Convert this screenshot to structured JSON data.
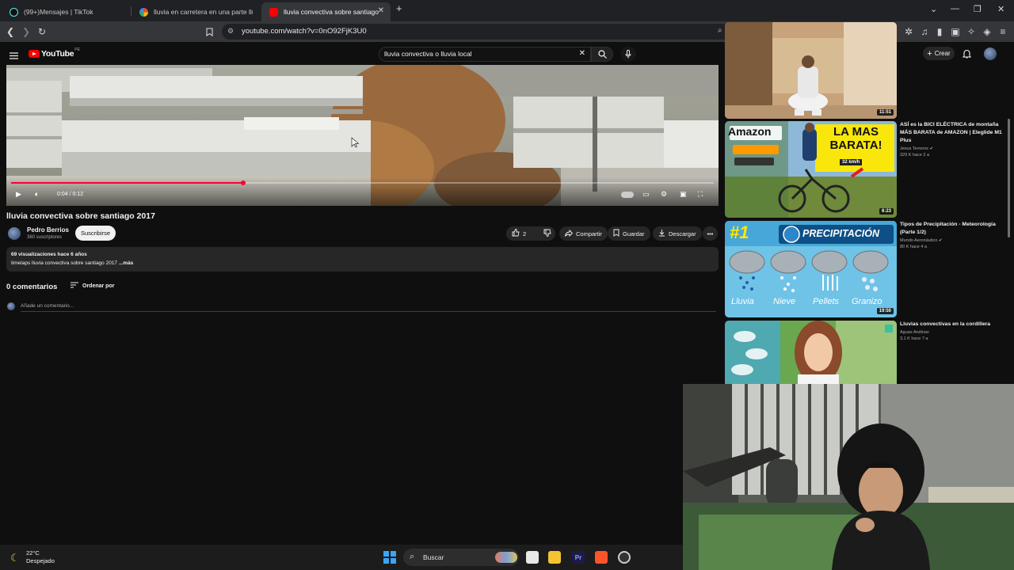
{
  "browser": {
    "tabs": [
      {
        "title": "(99+)Mensajes | TikTok",
        "active": false
      },
      {
        "title": "lluvia en carretera en una parte lluev",
        "active": false
      },
      {
        "title": "lluvia convectiva sobre santiago",
        "active": true
      }
    ],
    "new_tab": "+",
    "address": "youtube.com/watch?v=0nO92FjK3U0"
  },
  "youtube": {
    "logo_text": "YouTube",
    "logo_country": "PE",
    "search_query": "lluvia convectiva o lluvia local",
    "create_label": "Crear"
  },
  "player": {
    "time": "0:04 / 0:12",
    "progress": 0.33
  },
  "video": {
    "title": "lluvia convectiva sobre santiago 2017",
    "channel": "Pedro Berrios",
    "subscribers": "360 suscriptores",
    "subscribe_label": "Suscribirse",
    "likes": "2",
    "share_label": "Compartir",
    "save_label": "Guardar",
    "download_label": "Descargar",
    "views_line": "69 visualizaciones  hace 6 años",
    "description": "timelaps lluvia convectiva sobre santiago 2017",
    "more": "...más"
  },
  "comments": {
    "count_label": "0 comentarios",
    "sort_label": "Ordenar por",
    "placeholder": "Añade un comentario..."
  },
  "recommendations": [
    {
      "title": "",
      "channel": "",
      "views": "",
      "duration": "11:51"
    },
    {
      "title": "ASÍ es la BICI ELÉCTRICA de montaña MÁS BARATA de AMAZON | Eleglide M1 Plus",
      "channel": "Jesus Terreros",
      "views": "329 K  hace 2 a",
      "duration": "6:23",
      "thumb_text": {
        "brand": "Amazon",
        "headline": "LA MAS BARATA!",
        "speed": "32 km/h"
      }
    },
    {
      "title": "Tipos de Precipitación - Meteorología (Parte 1/2)",
      "channel": "Mundo Aeronáutico",
      "views": "80 K  hace 4 a",
      "duration": "19:50",
      "thumb_text": {
        "number": "#1",
        "headline": "PRECIPITACIÓN",
        "labels": [
          "Lluvia",
          "Nieve",
          "Pellets",
          "Granizo"
        ]
      }
    },
    {
      "title": "Lluvias convectivas en la cordillera",
      "channel": "Aguas Andinas",
      "views": "3,1 K  hace 7 a",
      "duration": ""
    }
  ],
  "taskbar": {
    "temperature": "22°C",
    "weather": "Despejado",
    "search_label": "Buscar"
  },
  "colors": {
    "youtube_red": "#ff0000",
    "progress_red": "#ff0033",
    "background": "#0f0f0f"
  }
}
